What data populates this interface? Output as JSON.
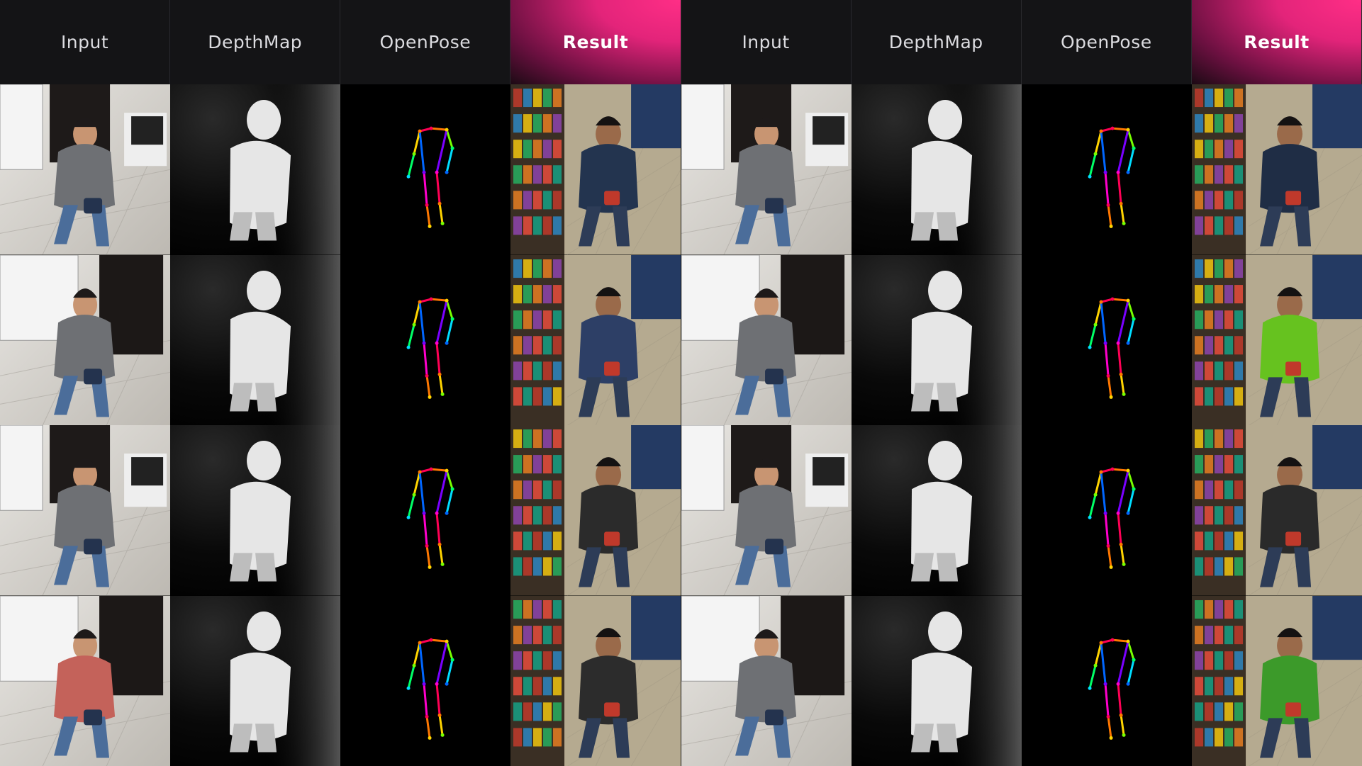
{
  "headers": [
    "Input",
    "DepthMap",
    "OpenPose",
    "Result",
    "Input",
    "DepthMap",
    "OpenPose",
    "Result"
  ],
  "columns": [
    "input",
    "depthmap",
    "openpose",
    "result",
    "input",
    "depthmap",
    "openpose",
    "result"
  ],
  "rows": 4,
  "colors": {
    "header_bg": "#141416",
    "result_accent": "#ff2e86",
    "depth_bg": "#000000",
    "pose_bg": "#000000"
  }
}
